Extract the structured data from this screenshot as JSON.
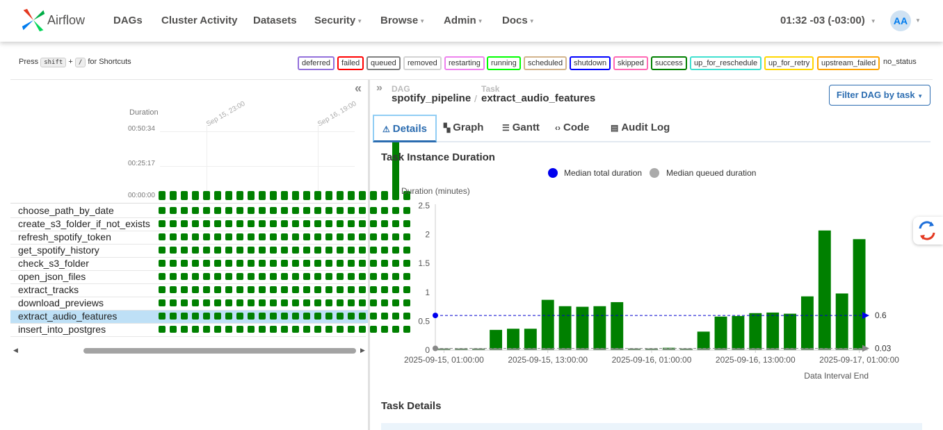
{
  "navbar": {
    "brand": "Airflow",
    "items": [
      "DAGs",
      "Cluster Activity",
      "Datasets",
      "Security",
      "Browse",
      "Admin",
      "Docs"
    ],
    "time": "01:32 -03 (-03:00)",
    "avatar": "AA"
  },
  "shortcut": {
    "press": "Press",
    "key1": "shift",
    "plus": "+",
    "key2": "/",
    "suffix": "for Shortcuts"
  },
  "states": [
    {
      "label": "deferred",
      "color": "#9370db"
    },
    {
      "label": "failed",
      "color": "#ff0000"
    },
    {
      "label": "queued",
      "color": "#808080"
    },
    {
      "label": "removed",
      "color": "#d3d3d3"
    },
    {
      "label": "restarting",
      "color": "#ee82ee"
    },
    {
      "label": "running",
      "color": "#00ff00"
    },
    {
      "label": "scheduled",
      "color": "#d2b48c"
    },
    {
      "label": "shutdown",
      "color": "#0000ff"
    },
    {
      "label": "skipped",
      "color": "#ff69b4"
    },
    {
      "label": "success",
      "color": "#008000"
    },
    {
      "label": "up_for_reschedule",
      "color": "#40e0d0"
    },
    {
      "label": "up_for_retry",
      "color": "#ffd700"
    },
    {
      "label": "upstream_failed",
      "color": "#ffa500"
    },
    {
      "label": "no_status",
      "color": ""
    }
  ],
  "grid": {
    "duration_label": "Duration",
    "y_ticks": [
      "00:50:34",
      "00:25:17",
      "00:00:00"
    ],
    "date_labels": [
      "Sep 15, 23:00",
      "Sep 16, 19:00"
    ],
    "run_durations": [
      0.05,
      0.05,
      0.05,
      0.05,
      0.05,
      0.05,
      0.05,
      0.05,
      0.05,
      0.05,
      0.05,
      0.05,
      0.05,
      0.05,
      0.05,
      0.05,
      0.05,
      0.05,
      0.05,
      0.05,
      0.08,
      1.0,
      0.05
    ],
    "tasks": [
      "choose_path_by_date",
      "create_s3_folder_if_not_exists",
      "refresh_spotify_token",
      "get_spotify_history",
      "check_s3_folder",
      "open_json_files",
      "extract_tracks",
      "download_previews",
      "extract_audio_features",
      "insert_into_postgres"
    ],
    "selected_task": "extract_audio_features",
    "success_color": "#008000"
  },
  "breadcrumb": {
    "dag_label": "DAG",
    "dag": "spotify_pipeline",
    "sep": "/",
    "task_label": "Task",
    "task": "extract_audio_features"
  },
  "filter_button": "Filter DAG by task",
  "tabs": [
    {
      "label": "Details",
      "icon": "⚠",
      "icon_name": "warning-icon",
      "active": true
    },
    {
      "label": "Graph",
      "icon": "▚",
      "icon_name": "graph-icon",
      "active": false
    },
    {
      "label": "Gantt",
      "icon": "☰",
      "icon_name": "gantt-icon",
      "active": false
    },
    {
      "label": "Code",
      "icon": "‹›",
      "icon_name": "code-icon",
      "active": false
    },
    {
      "label": "Audit Log",
      "icon": "▤",
      "icon_name": "audit-log-icon",
      "active": false
    }
  ],
  "chart_section": {
    "title": "Task Instance Duration",
    "legend_total": "Median total duration",
    "legend_queued": "Median queued duration"
  },
  "details_section": {
    "title": "Task Details"
  },
  "chart_data": {
    "type": "bar",
    "ylabel": "Duration (minutes)",
    "xlabel": "Data Interval End",
    "ylim": [
      0,
      2.5
    ],
    "y_ticks": [
      0,
      0.5,
      1,
      1.5,
      2,
      2.5
    ],
    "x_tick_labels": [
      "2025-09-15, 01:00:00",
      "2025-09-15, 13:00:00",
      "2025-09-16, 01:00:00",
      "2025-09-16, 13:00:00",
      "2025-09-17, 01:00:00"
    ],
    "x_tick_indices": [
      0,
      6,
      12,
      18,
      24
    ],
    "values": [
      0.03,
      0.03,
      0.03,
      0.35,
      0.37,
      0.37,
      0.87,
      0.76,
      0.75,
      0.76,
      0.83,
      0.03,
      0.03,
      0.04,
      0.03,
      0.32,
      0.58,
      0.59,
      0.64,
      0.65,
      0.63,
      0.93,
      2.07,
      0.98,
      1.92
    ],
    "queued_values": [
      0.03,
      0.03,
      0.03,
      0.03,
      0.03,
      0.03,
      0.03,
      0.03,
      0.03,
      0.03,
      0.03,
      0.03,
      0.03,
      0.03,
      0.03,
      0.03,
      0.03,
      0.03,
      0.03,
      0.03,
      0.03,
      0.03,
      0.03,
      0.03,
      0.03
    ],
    "median_total": 0.6,
    "median_queued": 0.03,
    "median_total_label": "0.6",
    "median_queued_label": "0.03",
    "bar_color": "#008000",
    "median_total_color": "#0000cc",
    "median_queued_color": "#888888",
    "grid": false,
    "legend": "top"
  }
}
